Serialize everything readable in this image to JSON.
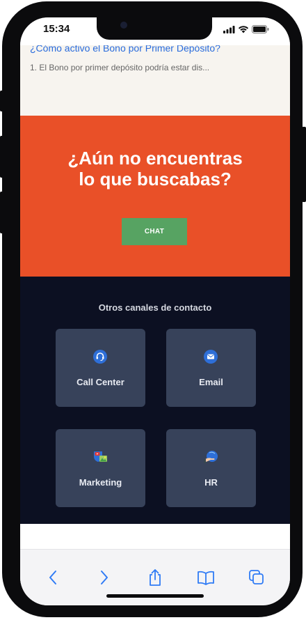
{
  "status_bar": {
    "time": "15:34",
    "icons": [
      "signal-icon",
      "wifi-icon",
      "battery-icon"
    ]
  },
  "faq": {
    "question": "¿Cómo activo el Bono por Primer Depósito?",
    "answer_preview": "1. El Bono por primer depósito podría estar dis..."
  },
  "cta": {
    "title_line1": "¿Aún no encuentras",
    "title_line2": "lo que buscabas?",
    "chat_label": "CHAT",
    "background_color": "#e95028",
    "button_color": "#57a362"
  },
  "channels": {
    "title": "Otros canales de contacto",
    "background_color": "#0c1022",
    "items": [
      {
        "label": "Call Center",
        "icon": "headset-icon"
      },
      {
        "label": "Email",
        "icon": "envelope-icon"
      },
      {
        "label": "Marketing",
        "icon": "marketing-icon"
      },
      {
        "label": "HR",
        "icon": "hand-icon"
      }
    ]
  },
  "toolbar": {
    "buttons": [
      "back-icon",
      "forward-icon",
      "share-icon",
      "bookmarks-icon",
      "tabs-icon"
    ],
    "accent_color": "#2f7bf5"
  }
}
